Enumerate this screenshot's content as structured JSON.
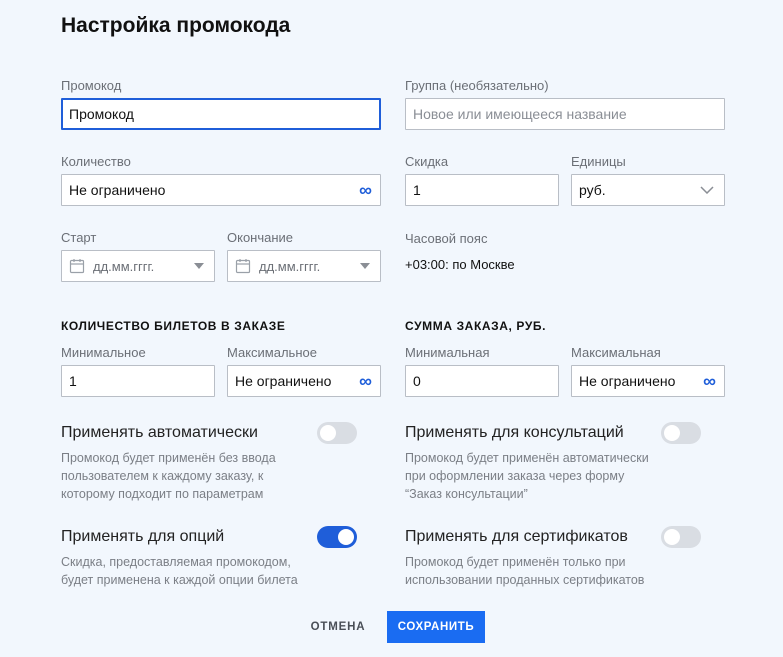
{
  "title": "Настройка промокода",
  "promo": {
    "label": "Промокод",
    "value": "Промокод"
  },
  "group": {
    "label": "Группа (необязательно)",
    "placeholder": "Новое или имеющееся название"
  },
  "quantity": {
    "label": "Количество",
    "value": "Не ограничено",
    "icon": "infinity-icon"
  },
  "discount": {
    "label": "Скидка",
    "value": "1"
  },
  "units": {
    "label": "Единицы",
    "value": "руб."
  },
  "start": {
    "label": "Старт",
    "placeholder": "дд.мм.гггг."
  },
  "end": {
    "label": "Окончание",
    "placeholder": "дд.мм.гггг."
  },
  "timezone": {
    "label": "Часовой пояс",
    "value": "+03:00: по Москве"
  },
  "tickets": {
    "heading": "КОЛИЧЕСТВО БИЛЕТОВ В ЗАКАЗЕ",
    "min_label": "Минимальное",
    "min_value": "1",
    "max_label": "Максимальное",
    "max_value": "Не ограничено"
  },
  "order_sum": {
    "heading": "СУММА ЗАКАЗА, РУБ.",
    "min_label": "Минимальная",
    "min_value": "0",
    "max_label": "Максимальная",
    "max_value": "Не ограничено"
  },
  "options": {
    "auto": {
      "title": "Применять автоматически",
      "desc": "Промокод будет применён без ввода пользователем к каждому заказу, к которому подходит по параметрам",
      "enabled": false
    },
    "consult": {
      "title": "Применять для консультаций",
      "desc": "Промокод будет применён автоматически при оформлении заказа через форму “Заказ консультации”",
      "enabled": false
    },
    "ticket_options": {
      "title": "Применять для опций",
      "desc": "Скидка, предоставляемая промокодом, будет применена к каждой опции билета",
      "enabled": true
    },
    "certificates": {
      "title": "Применять для сертификатов",
      "desc": "Промокод будет применён только при использовании проданных сертификатов",
      "enabled": false
    }
  },
  "buttons": {
    "cancel": "ОТМЕНА",
    "save": "СОХРАНИТЬ"
  },
  "colors": {
    "accent": "#1a6cf2",
    "background": "#f2f7fd",
    "toggle_off": "#d9dde3"
  }
}
